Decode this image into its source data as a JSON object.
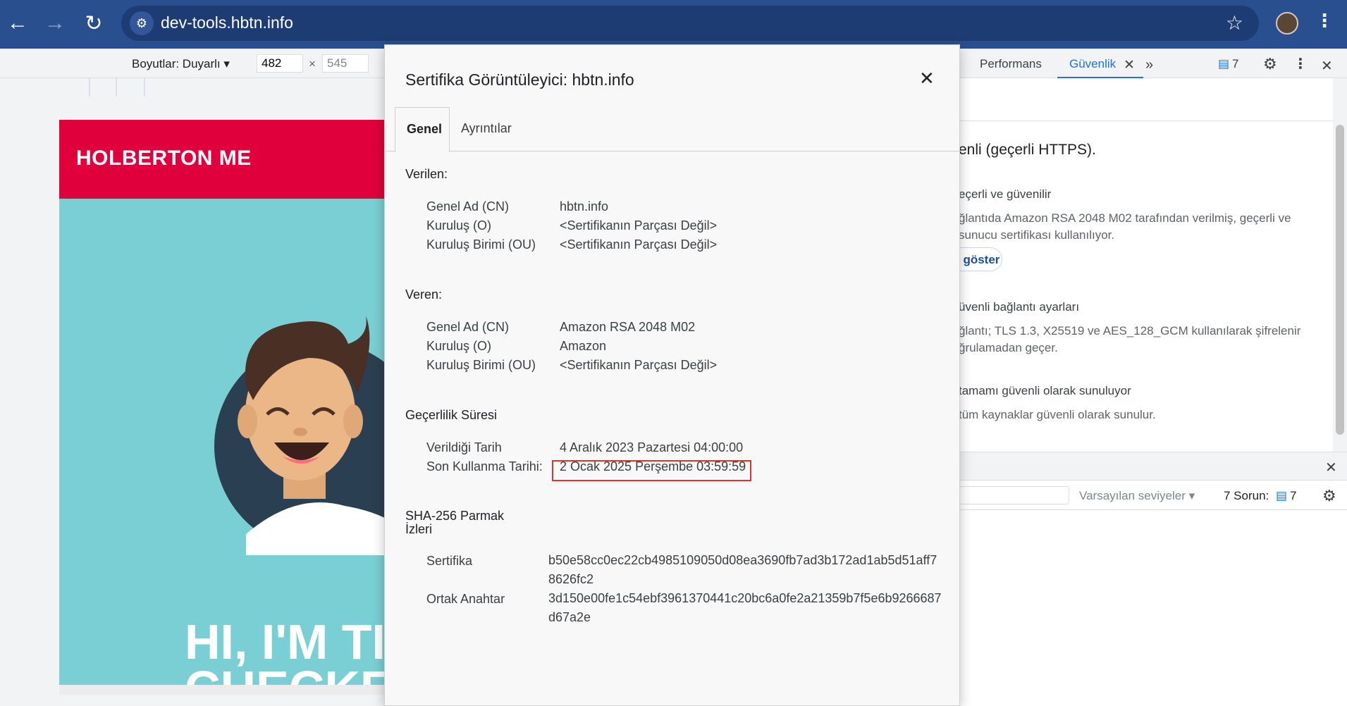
{
  "browser": {
    "url": "dev-tools.hbtn.info"
  },
  "device_toolbar": {
    "dimensions_label": "Boyutlar: Duyarlı ▾",
    "width": "482",
    "height": "545",
    "separator": "×"
  },
  "preview": {
    "brand": "HOLBERTON ME",
    "hero_line1": "HI, I'M TI",
    "hero_line2": "CHECKE"
  },
  "devtools": {
    "tabs": [
      "Performans",
      "Güvenlik"
    ],
    "issues_count": "7",
    "content": {
      "overview": "enli (geçerli HTTPS).",
      "cert_head": "eçerli ve güvenilir",
      "cert_desc1": "ğlantıda Amazon RSA 2048 M02 tarafından verilmiş, geçerli ve",
      "cert_desc2": "sunucu sertifikası kullanılıyor.",
      "show_button": "ı göster",
      "conn_head": "üvenli bağlantı ayarları",
      "conn_desc1": "ğlantı; TLS 1.3, X25519 ve AES_128_GCM kullanılarak şifrelenir",
      "conn_desc2": "ğrulamadan geçer.",
      "res_head": "tamamı güvenli olarak sunuluyor",
      "res_desc": "tüm kaynaklar güvenli olarak sunulur."
    },
    "console": {
      "levels": "Varsayılan seviyeler ▾",
      "issues_label": "7 Sorun:",
      "issues_count": "7"
    }
  },
  "dialog": {
    "title": "Sertifika Görüntüleyici: hbtn.info",
    "tabs": [
      "Genel",
      "Ayrıntılar"
    ],
    "issued_to": {
      "heading": "Verilen:",
      "rows": [
        {
          "key": "Genel Ad (CN)",
          "value": "hbtn.info"
        },
        {
          "key": "Kuruluş (O)",
          "value": "<Sertifikanın Parçası Değil>"
        },
        {
          "key": "Kuruluş Birimi (OU)",
          "value": "<Sertifikanın Parçası Değil>"
        }
      ]
    },
    "issued_by": {
      "heading": "Veren:",
      "rows": [
        {
          "key": "Genel Ad (CN)",
          "value": "Amazon RSA 2048 M02"
        },
        {
          "key": "Kuruluş (O)",
          "value": "Amazon"
        },
        {
          "key": "Kuruluş Birimi (OU)",
          "value": "<Sertifikanın Parçası Değil>"
        }
      ]
    },
    "validity": {
      "heading": "Geçerlilik Süresi",
      "rows": [
        {
          "key": "Verildiği Tarih",
          "value": "4 Aralık 2023 Pazartesi 04:00:00"
        },
        {
          "key": "Son Kullanma Tarihi:",
          "value": "2 Ocak 2025 Perşembe 03:59:59"
        }
      ]
    },
    "fingerprints": {
      "heading_line1": "SHA-256 Parmak",
      "heading_line2": "İzleri",
      "rows": [
        {
          "key": "Sertifika",
          "value": "b50e58cc0ec22cb4985109050d08ea3690fb7ad3b172ad1ab5d51aff78626fc2"
        },
        {
          "key": "Ortak Anahtar",
          "value": "3d150e00fe1c54ebf3961370441c20bc6a0fe2a21359b7f5e6b9266687d67a2e"
        }
      ]
    }
  }
}
